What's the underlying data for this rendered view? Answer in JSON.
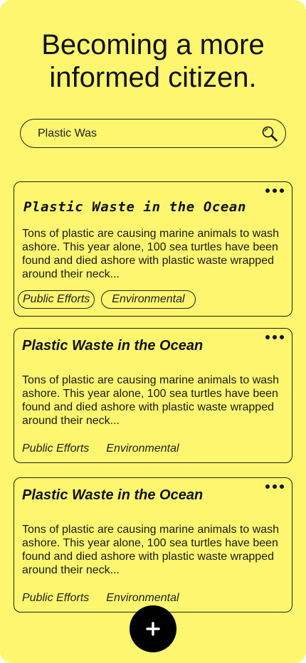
{
  "header": {
    "title_line1": "Becoming a more",
    "title_line2": "informed citizen."
  },
  "search": {
    "value": "Plastic Was",
    "icon": "search-icon"
  },
  "articles": [
    {
      "title": "Plastic Waste in the Ocean",
      "body": "Tons of plastic are causing marine animals to wash ashore. This year alone, 100 sea turtles have been found and died ashore with plastic waste wrapped around their neck...",
      "tags": [
        "Public Efforts",
        "Environmental"
      ],
      "menu_icon": "more-dots-icon"
    },
    {
      "title": "Plastic Waste in the Ocean",
      "body": "Tons of plastic are causing marine animals to wash ashore. This year alone, 100 sea turtles have been found and died ashore with plastic waste wrapped around their neck...",
      "tags": [
        "Public Efforts",
        "Environmental"
      ],
      "menu_icon": "more-dots-icon"
    },
    {
      "title": "Plastic Waste in the Ocean",
      "body": "Tons of plastic are causing marine animals to wash ashore. This year alone, 100 sea turtles have been found and died ashore with plastic waste wrapped around their neck...",
      "tags": [
        "Public Efforts",
        "Environmental"
      ],
      "menu_icon": "more-dots-icon"
    }
  ],
  "fab": {
    "icon": "plus-icon"
  },
  "colors": {
    "background": "#fdf66e",
    "ink": "#111111",
    "fab": "#000000"
  }
}
